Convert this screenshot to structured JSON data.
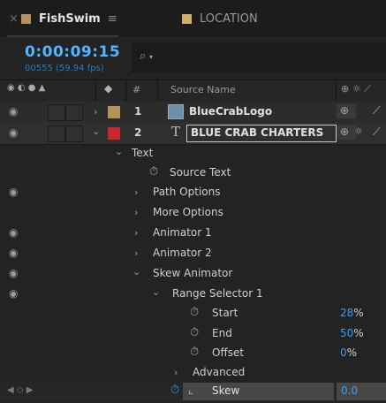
{
  "tabs": [
    {
      "name": "FishSwim",
      "color": "#b8925e"
    },
    {
      "name": "LOCATION",
      "color": "#d2b06a"
    }
  ],
  "icons": {
    "close": "×",
    "menu": "≡",
    "search": "⌕",
    "eye": "◉",
    "chevron_right": "›",
    "chevron_down": "⌄",
    "stopwatch": "⏱",
    "text_layer": "T",
    "graph": "⌞"
  },
  "timecode": {
    "time": "0:00:09:15",
    "frames": "00555 (59.94 fps)"
  },
  "search": {
    "icon": "⌕",
    "dropdown": "▾"
  },
  "columns": {
    "hash": "#",
    "source_name": "Source Name"
  },
  "layers": [
    {
      "num": "1",
      "name": "BlueCrabLogo",
      "label_color": "#b8925e"
    },
    {
      "num": "2",
      "name": "BLUE CRAB CHARTERS",
      "label_color": "#c8282c",
      "type_icon": "T"
    }
  ],
  "properties": [
    {
      "label": "Text"
    },
    {
      "label": "Source Text"
    },
    {
      "label": "Path Options"
    },
    {
      "label": "More Options"
    },
    {
      "label": "Animator 1"
    },
    {
      "label": "Animator 2"
    },
    {
      "label": "Skew Animator"
    },
    {
      "label": "Range Selector 1"
    },
    {
      "label": "Start",
      "value": "28",
      "unit": "%"
    },
    {
      "label": "End",
      "value": "50",
      "unit": "%"
    },
    {
      "label": "Offset",
      "value": "0",
      "unit": "%"
    },
    {
      "label": "Advanced"
    },
    {
      "label": "Skew",
      "value": "0.0"
    }
  ],
  "colors": {
    "accent": "#3a9cf0",
    "timecode": "#4fb6ff"
  }
}
